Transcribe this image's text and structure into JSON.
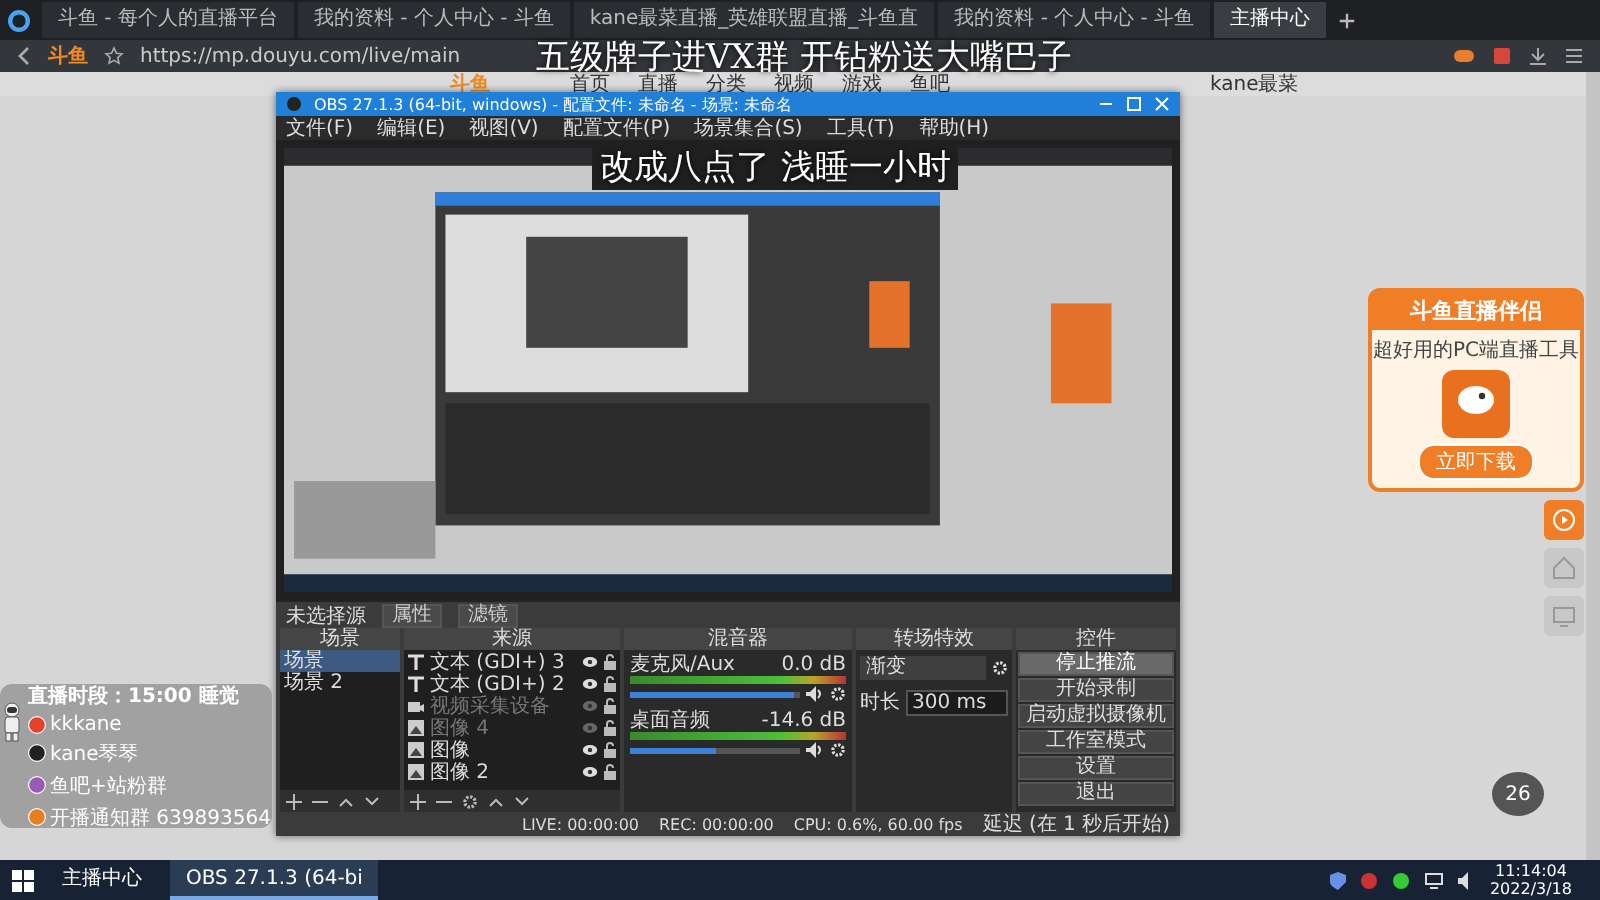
{
  "browser": {
    "tabs": [
      {
        "title": "斗鱼 - 每个人的直播平台",
        "selected": false
      },
      {
        "title": "我的资料 - 个人中心 - 斗鱼",
        "selected": false
      },
      {
        "title": "kane最菜直播_英雄联盟直播_斗鱼直",
        "selected": false
      },
      {
        "title": "我的资料 - 个人中心 - 斗鱼",
        "selected": false
      },
      {
        "title": "主播中心",
        "selected": true
      }
    ],
    "logo": "斗鱼",
    "url": "https://mp.douyu.com/live/main"
  },
  "site_header": {
    "logo": "斗鱼",
    "nav": [
      "首页",
      "直播",
      "分类",
      "视频",
      "游戏",
      "鱼吧"
    ],
    "user": "kane最菜"
  },
  "overlay_text": [
    "五级牌子进VX群  开钻粉送大嘴巴子",
    "改成八点了 浅睡一小时"
  ],
  "obs": {
    "title": "OBS 27.1.3 (64-bit, windows) - 配置文件: 未命名 - 场景: 未命名",
    "menu": [
      "文件(F)",
      "编辑(E)",
      "视图(V)",
      "配置文件(P)",
      "场景集合(S)",
      "工具(T)",
      "帮助(H)"
    ],
    "no_source": "未选择源",
    "source_buttons": [
      "属性",
      "滤镜"
    ],
    "scenes": {
      "title": "场景",
      "items": [
        {
          "name": "场景",
          "selected": true
        },
        {
          "name": "场景 2",
          "selected": false
        }
      ]
    },
    "sources": {
      "title": "来源",
      "items": [
        {
          "name": "文本 (GDI+) 3",
          "kind": "text",
          "visible": true
        },
        {
          "name": "文本 (GDI+) 2",
          "kind": "text",
          "visible": true
        },
        {
          "name": "视频采集设备",
          "kind": "camera",
          "visible": false
        },
        {
          "name": "图像 4",
          "kind": "image",
          "visible": false
        },
        {
          "name": "图像",
          "kind": "image",
          "visible": true
        },
        {
          "name": "图像 2",
          "kind": "image",
          "visible": true
        }
      ]
    },
    "mixer": {
      "title": "混音器",
      "channels": [
        {
          "name": "麦克风/Aux",
          "reading": "0.0 dB",
          "level": 0.96
        },
        {
          "name": "桌面音频",
          "reading": "-14.6 dB",
          "level": 0.5
        }
      ]
    },
    "transitions": {
      "title": "转场特效",
      "transition": "渐变",
      "duration_label": "时长",
      "duration": "300 ms"
    },
    "controls": {
      "title": "控件",
      "buttons": [
        {
          "label": "停止推流",
          "active": true
        },
        {
          "label": "开始录制",
          "active": false
        },
        {
          "label": "启动虚拟摄像机",
          "active": false
        },
        {
          "label": "工作室模式",
          "active": false
        },
        {
          "label": "设置",
          "active": false
        },
        {
          "label": "退出",
          "active": false
        }
      ]
    },
    "status": {
      "live": "LIVE: 00:00:00",
      "rec": "REC: 00:00:00",
      "cpu": "CPU: 0.6%, 60.00 fps",
      "note": "延迟 (在 1 秒后开始)"
    }
  },
  "schedule_panel": {
    "lines": [
      {
        "kind": "title",
        "text": "直播时段：15:00 睡觉"
      },
      {
        "kind": "douyu",
        "text": "kkkane"
      },
      {
        "kind": "tiktok",
        "text": "kane琴琴"
      },
      {
        "kind": "group",
        "text": "鱼吧+站粉群"
      },
      {
        "kind": "notice",
        "text": "开播通知群 639893564"
      }
    ]
  },
  "promo_card": {
    "title": "斗鱼直播伴侣",
    "subtitle": "超好用的PC端直播工具",
    "button": "立即下载"
  },
  "progress_bubble": "26",
  "taskbar": {
    "apps": [
      {
        "label": "主播中心",
        "active": false
      },
      {
        "label": "OBS 27.1.3 (64-bi",
        "active": true
      }
    ],
    "time": "11:14:04",
    "date": "2022/3/18"
  }
}
